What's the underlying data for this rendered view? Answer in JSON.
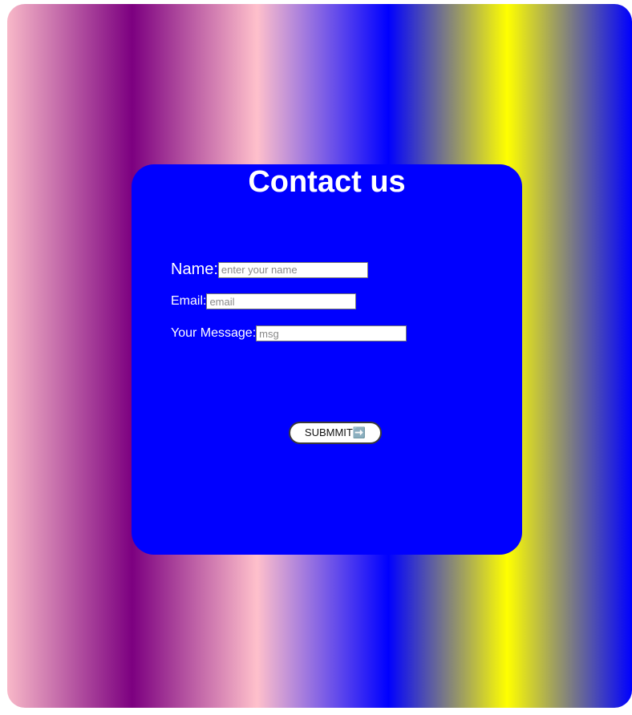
{
  "title": "Contact us",
  "form": {
    "name_label": "Name:",
    "name_placeholder": "enter your name",
    "email_label": "Email:",
    "email_placeholder": "email",
    "message_label": "Your Message:",
    "message_placeholder": "msg",
    "submit_label": "SUBMMIT➡️"
  },
  "colors": {
    "card": "#0000ff",
    "text": "#ffffff",
    "gradient": [
      "#f8b8c8",
      "#7c0080",
      "#ffc0cb",
      "#0000ff",
      "#ffff00",
      "#0000ff"
    ]
  }
}
